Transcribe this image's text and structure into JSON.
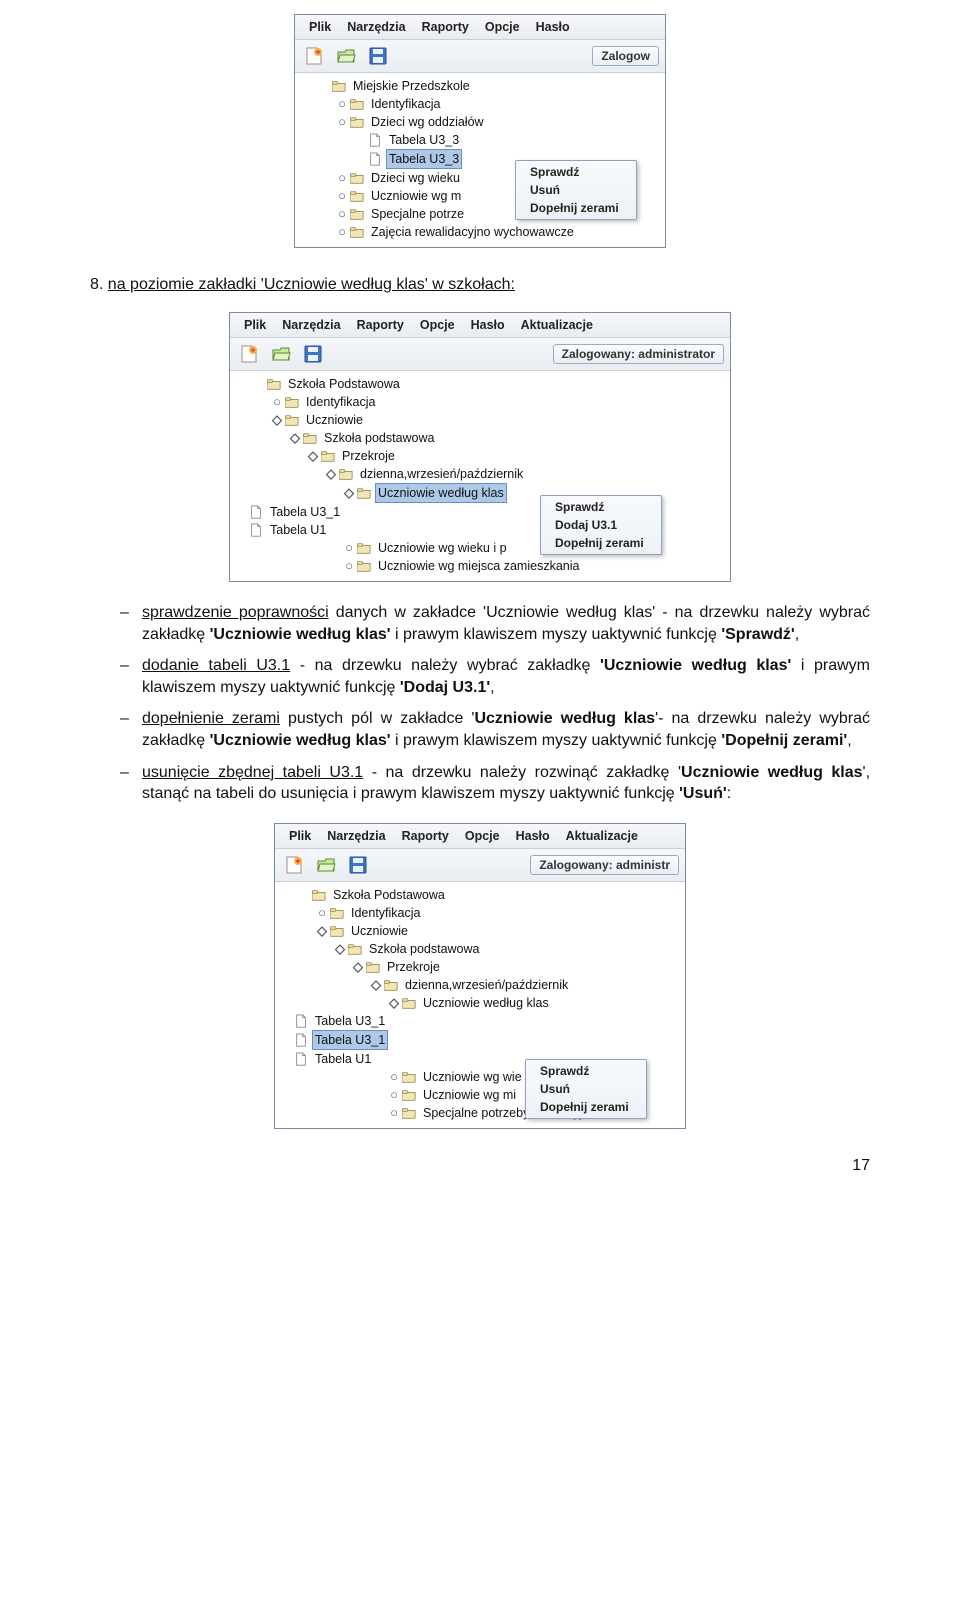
{
  "page_number": "17",
  "heading": {
    "num": "8.",
    "text": "na poziomie zakładki 'Uczniowie według klas' w szkołach:"
  },
  "bullets": {
    "b1": {
      "u": "sprawdzenie poprawności",
      "rest": " danych w zakładce 'Uczniowie według klas' - na drzewku należy wybrać zakładkę ",
      "bold1": "'Uczniowie według klas'",
      "rest2": " i prawym klawiszem myszy uaktywnić funkcję ",
      "bold2": "'Sprawdź'",
      "comma": ","
    },
    "b2": {
      "u": "dodanie tabeli U3.1",
      "rest": " - na drzewku należy wybrać zakładkę ",
      "bold1": "'Uczniowie według klas'",
      "rest2": " i prawym klawiszem myszy uaktywnić funkcję ",
      "bold2": "'Dodaj U3.1'",
      "comma": ","
    },
    "b3": {
      "u": "dopełnienie zerami",
      "rest": " pustych pól w zakładce '",
      "bold0": "Uczniowie według klas",
      "rest0b": "'- na drzewku należy wybrać zakładkę ",
      "bold1": "'Uczniowie według klas'",
      "rest2": " i prawym klawiszem myszy uaktywnić funkcję ",
      "bold2": "'Dopełnij zerami'",
      "comma": ","
    },
    "b4": {
      "u": "usunięcie zbędnej tabeli U3.1",
      "rest": " - na drzewku należy rozwinąć zakładkę '",
      "bold0": "Uczniowie według klas",
      "rest0b": "', stanąć na tabeli do usunięcia i prawym klawiszem myszy uaktywnić funkcję ",
      "bold2": "'Usuń'",
      "colon": ":"
    }
  },
  "shot1": {
    "menubar": [
      "Plik",
      "Narzędzia",
      "Raporty",
      "Opcje",
      "Hasło"
    ],
    "login_label": "Zalogow",
    "tree": [
      {
        "indent": 0,
        "toggle": "",
        "icon": "folder",
        "label": "Miejskie Przedszkole",
        "sel": false
      },
      {
        "indent": 1,
        "toggle": "o-",
        "icon": "folder",
        "label": "Identyfikacja",
        "sel": false
      },
      {
        "indent": 1,
        "toggle": "o-",
        "icon": "folder",
        "label": "Dzieci wg oddziałów",
        "sel": false
      },
      {
        "indent": 2,
        "toggle": "",
        "icon": "doc",
        "label": "Tabela U3_3",
        "sel": false
      },
      {
        "indent": 2,
        "toggle": "",
        "icon": "doc",
        "label": "Tabela U3_3",
        "sel": true
      },
      {
        "indent": 1,
        "toggle": "o-",
        "icon": "folder",
        "label": "Dzieci wg wieku",
        "sel": false
      },
      {
        "indent": 1,
        "toggle": "o-",
        "icon": "folder",
        "label": "Uczniowie wg m",
        "sel": false
      },
      {
        "indent": 1,
        "toggle": "o-",
        "icon": "folder",
        "label": "Specjalne potrze",
        "sel": false
      },
      {
        "indent": 1,
        "toggle": "o-",
        "icon": "folder",
        "label": "Zajęcia rewalidacyjno wychowawcze",
        "sel": false
      }
    ],
    "ctx": [
      "Sprawdź",
      "Usuń",
      "Dopełnij zerami"
    ]
  },
  "shot2": {
    "menubar": [
      "Plik",
      "Narzędzia",
      "Raporty",
      "Opcje",
      "Hasło",
      "Aktualizacje"
    ],
    "login_label": "Zalogowany: administrator",
    "tree": [
      {
        "indent": 0,
        "toggle": "",
        "icon": "folder",
        "label": "Szkoła Podstawowa",
        "sel": false
      },
      {
        "indent": 1,
        "toggle": "o-",
        "icon": "folder",
        "label": "Identyfikacja",
        "sel": false
      },
      {
        "indent": 1,
        "toggle": "o",
        "icon": "folder",
        "label": "Uczniowie",
        "sel": false
      },
      {
        "indent": 2,
        "toggle": "o",
        "icon": "folder",
        "label": "Szkoła podstawowa",
        "sel": false
      },
      {
        "indent": 3,
        "toggle": "o",
        "icon": "folder",
        "label": "Przekroje",
        "sel": false
      },
      {
        "indent": 4,
        "toggle": "o",
        "icon": "folder",
        "label": "dzienna,wrzesień/październik",
        "sel": false
      },
      {
        "indent": 5,
        "toggle": "o",
        "icon": "folder",
        "label": "Uczniowie według klas",
        "sel": true
      },
      {
        "indent": 6,
        "toggle": "",
        "icon": "doc",
        "label": "Tabela U3_1",
        "sel": false
      },
      {
        "indent": 6,
        "toggle": "",
        "icon": "doc",
        "label": "Tabela U1",
        "sel": false
      },
      {
        "indent": 5,
        "toggle": "o-",
        "icon": "folder",
        "label": "Uczniowie wg wieku i p",
        "sel": false
      },
      {
        "indent": 5,
        "toggle": "o-",
        "icon": "folder",
        "label": "Uczniowie wg miejsca zamieszkania",
        "sel": false
      }
    ],
    "ctx": [
      "Sprawdź",
      "Dodaj U3.1",
      "Dopełnij zerami"
    ]
  },
  "shot3": {
    "menubar": [
      "Plik",
      "Narzędzia",
      "Raporty",
      "Opcje",
      "Hasło",
      "Aktualizacje"
    ],
    "login_label": "Zalogowany: administr",
    "tree": [
      {
        "indent": 0,
        "toggle": "",
        "icon": "folder",
        "label": "Szkoła Podstawowa",
        "sel": false
      },
      {
        "indent": 1,
        "toggle": "o-",
        "icon": "folder",
        "label": "Identyfikacja",
        "sel": false
      },
      {
        "indent": 1,
        "toggle": "o",
        "icon": "folder",
        "label": "Uczniowie",
        "sel": false
      },
      {
        "indent": 2,
        "toggle": "o",
        "icon": "folder",
        "label": "Szkoła podstawowa",
        "sel": false
      },
      {
        "indent": 3,
        "toggle": "o",
        "icon": "folder",
        "label": "Przekroje",
        "sel": false
      },
      {
        "indent": 4,
        "toggle": "o",
        "icon": "folder",
        "label": "dzienna,wrzesień/październik",
        "sel": false
      },
      {
        "indent": 5,
        "toggle": "o",
        "icon": "folder",
        "label": "Uczniowie według klas",
        "sel": false
      },
      {
        "indent": 6,
        "toggle": "",
        "icon": "doc",
        "label": "Tabela U3_1",
        "sel": false
      },
      {
        "indent": 6,
        "toggle": "",
        "icon": "doc",
        "label": "Tabela U3_1",
        "sel": true
      },
      {
        "indent": 6,
        "toggle": "",
        "icon": "doc",
        "label": "Tabela U1",
        "sel": false
      },
      {
        "indent": 5,
        "toggle": "o-",
        "icon": "folder",
        "label": "Uczniowie wg wie",
        "sel": false
      },
      {
        "indent": 5,
        "toggle": "o-",
        "icon": "folder",
        "label": "Uczniowie wg mi",
        "sel": false
      },
      {
        "indent": 5,
        "toggle": "o-",
        "icon": "folder",
        "label": "Specjalne potrzeby edukacyjne",
        "sel": false
      }
    ],
    "ctx": [
      "Sprawdź",
      "Usuń",
      "Dopełnij zerami"
    ]
  }
}
